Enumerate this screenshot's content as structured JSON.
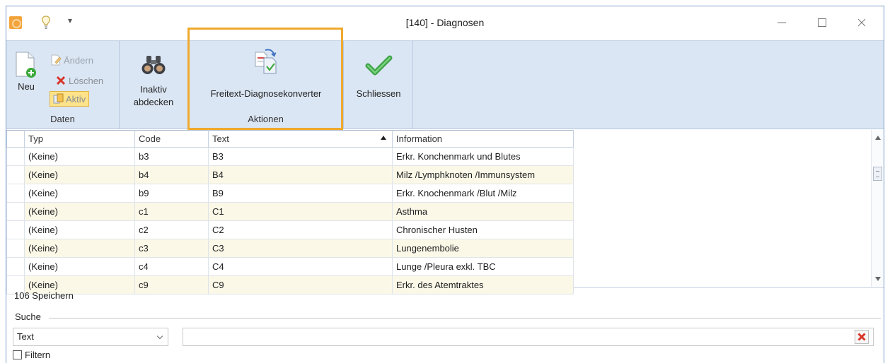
{
  "window": {
    "title": "[140] - Diagnosen",
    "qat_arrow": "▾",
    "controls": {
      "minimize": "—",
      "maximize": "☐",
      "close": "✕"
    }
  },
  "ribbon": {
    "groups": {
      "daten": {
        "label": "Daten",
        "neu": "Neu",
        "aendern": "Ändern",
        "loeschen": "Löschen",
        "aktiv": "Aktiv"
      },
      "inaktiv": {
        "label_line1": "Inaktiv",
        "label_line2": "abdecken"
      },
      "aktionen": {
        "label": "Aktionen",
        "freitext": "Freitext-Diagnosekonverter"
      },
      "schliessen": {
        "label": "Schliessen"
      }
    },
    "highlight_color": "#f0a92c"
  },
  "grid": {
    "columns": [
      "Typ",
      "Code",
      "Text",
      "Information"
    ],
    "sorted_column": "Text",
    "sort_direction": "ascending",
    "rows": [
      {
        "typ": "(Keine)",
        "code": "b3",
        "text": "B3",
        "info": "Erkr. Konchenmark und Blutes"
      },
      {
        "typ": "(Keine)",
        "code": "b4",
        "text": "B4",
        "info": "Milz /Lymphknoten /Immunsystem"
      },
      {
        "typ": "(Keine)",
        "code": "b9",
        "text": "B9",
        "info": "Erkr. Knochenmark /Blut /Milz"
      },
      {
        "typ": "(Keine)",
        "code": "c1",
        "text": "C1",
        "info": "Asthma"
      },
      {
        "typ": "(Keine)",
        "code": "c2",
        "text": "C2",
        "info": "Chronischer Husten"
      },
      {
        "typ": "(Keine)",
        "code": "c3",
        "text": "C3",
        "info": "Lungenembolie"
      },
      {
        "typ": "(Keine)",
        "code": "c4",
        "text": "C4",
        "info": "Lunge /Pleura exkl. TBC"
      },
      {
        "typ": "(Keine)",
        "code": "c9",
        "text": "C9",
        "info": "Erkr. des Atemtraktes"
      }
    ]
  },
  "status": {
    "count_text": "106 Speichern"
  },
  "search": {
    "label": "Suche",
    "field": "Text",
    "query": "",
    "filter_label": "Filtern",
    "filter_checked": false
  }
}
